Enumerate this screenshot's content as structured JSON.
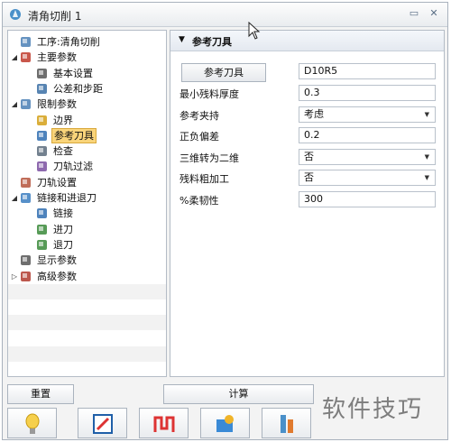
{
  "window": {
    "title": "清角切削 1"
  },
  "tree": {
    "items": [
      {
        "label": "工序:清角切削",
        "icon": "operation-icon",
        "expander": ""
      },
      {
        "label": "主要参数",
        "icon": "main-params-icon",
        "expander": "◢"
      },
      {
        "label": "基本设置",
        "icon": "basic-settings-icon",
        "expander": ""
      },
      {
        "label": "公差和步距",
        "icon": "tolerance-icon",
        "expander": ""
      },
      {
        "label": "限制参数",
        "icon": "limit-params-icon",
        "expander": "◢"
      },
      {
        "label": "边界",
        "icon": "boundary-icon",
        "expander": ""
      },
      {
        "label": "参考刀具",
        "icon": "reference-tool-icon",
        "expander": "",
        "selected": true
      },
      {
        "label": "检查",
        "icon": "check-icon",
        "expander": ""
      },
      {
        "label": "刀轨过滤",
        "icon": "toolpath-filter-icon",
        "expander": ""
      },
      {
        "label": "刀轨设置",
        "icon": "toolpath-settings-icon",
        "expander": ""
      },
      {
        "label": "链接和进退刀",
        "icon": "link-icon",
        "expander": "◢"
      },
      {
        "label": "链接",
        "icon": "link-sub-icon",
        "expander": ""
      },
      {
        "label": "进刀",
        "icon": "lead-in-icon",
        "expander": ""
      },
      {
        "label": "退刀",
        "icon": "lead-out-icon",
        "expander": ""
      },
      {
        "label": "显示参数",
        "icon": "display-params-icon",
        "expander": ""
      },
      {
        "label": "高级参数",
        "icon": "advanced-params-icon",
        "expander": "▷"
      }
    ]
  },
  "panel": {
    "header": "参考刀具",
    "tool_button": "参考刀具",
    "tool_value": "D10R5",
    "rows": [
      {
        "label": "最小残料厚度",
        "value": "0.3",
        "dropdown": false
      },
      {
        "label": "参考夹持",
        "value": "考虑",
        "dropdown": true
      },
      {
        "label": "正负偏差",
        "value": "0.2",
        "dropdown": false
      },
      {
        "label": "三维转为二维",
        "value": "否",
        "dropdown": true
      },
      {
        "label": "残料粗加工",
        "value": "否",
        "dropdown": true
      },
      {
        "label": "%柔韧性",
        "value": "300",
        "dropdown": false
      }
    ]
  },
  "buttons": {
    "reset": "重置",
    "compute": "计算"
  },
  "icon_buttons": [
    "lightbulb-icon",
    "edit-icon",
    "toolpath-icon",
    "simulate-icon",
    "tool-icon"
  ],
  "watermark": "软件技巧"
}
